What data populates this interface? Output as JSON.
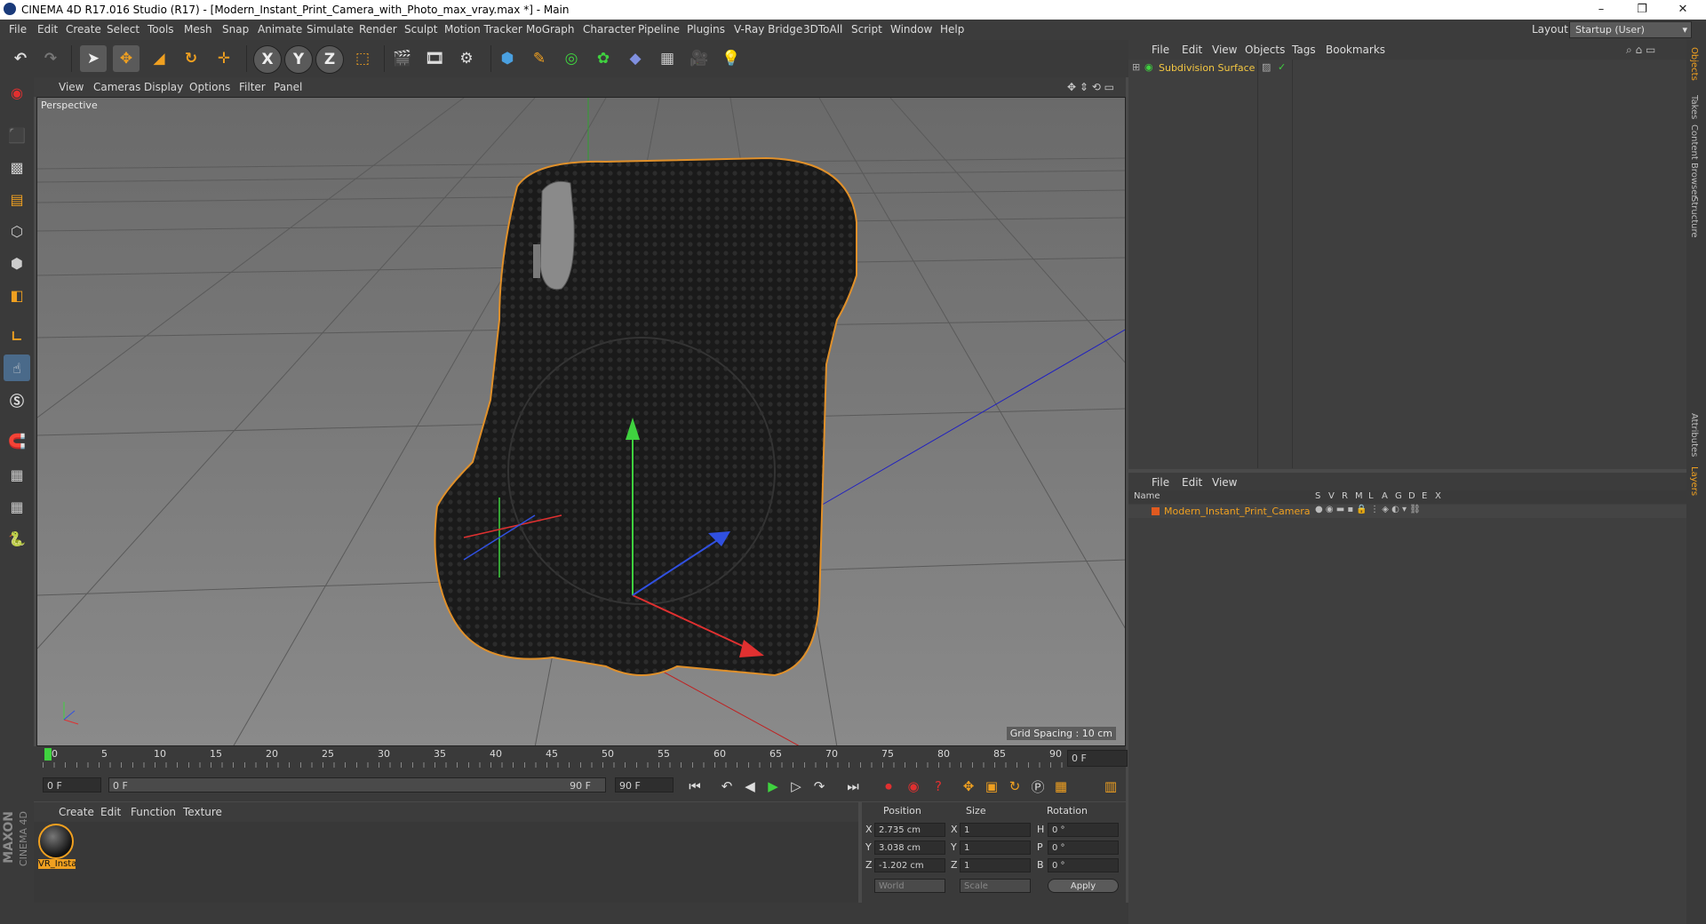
{
  "window": {
    "title": "CINEMA 4D R17.016 Studio (R17) - [Modern_Instant_Print_Camera_with_Photo_max_vray.max *] - Main",
    "controls": [
      "–",
      "❐",
      "✕"
    ]
  },
  "menubar": {
    "items": [
      "File",
      "Edit",
      "Create",
      "Select",
      "Tools",
      "Mesh",
      "Snap",
      "Animate",
      "Simulate",
      "Render",
      "Sculpt",
      "Motion Tracker",
      "MoGraph",
      "Character",
      "Pipeline",
      "Plugins",
      "V-Ray Bridge",
      "3DToAll",
      "Script",
      "Window",
      "Help"
    ],
    "layout_label": "Layout:",
    "layout_value": "Startup (User)"
  },
  "toolbar": {
    "axis_x": "X",
    "axis_y": "Y",
    "axis_z": "Z"
  },
  "viewport": {
    "menu": [
      "View",
      "Cameras",
      "Display",
      "Options",
      "Filter",
      "Panel"
    ],
    "label": "Perspective",
    "grid_spacing": "Grid Spacing : 10 cm"
  },
  "timeline": {
    "ticks": [
      "0",
      "5",
      "10",
      "15",
      "20",
      "25",
      "30",
      "35",
      "40",
      "45",
      "50",
      "55",
      "60",
      "65",
      "70",
      "75",
      "80",
      "85",
      "90"
    ],
    "current_frame": "0 F"
  },
  "transport": {
    "start_field": "0 F",
    "range_start": "0 F",
    "range_end": "90 F",
    "end_field": "90 F"
  },
  "material_manager": {
    "menu": [
      "Create",
      "Edit",
      "Function",
      "Texture"
    ],
    "material_name": "VR_Insta",
    "brand_maxon": "MAXON",
    "brand_c4d": "CINEMA 4D"
  },
  "coordinates": {
    "headers": [
      "Position",
      "Size",
      "Rotation"
    ],
    "rows": [
      {
        "axis": "X",
        "pos": "2.735 cm",
        "size_axis": "X",
        "size": "1",
        "rot_axis": "H",
        "rot": "0 °"
      },
      {
        "axis": "Y",
        "pos": "3.038 cm",
        "size_axis": "Y",
        "size": "1",
        "rot_axis": "P",
        "rot": "0 °"
      },
      {
        "axis": "Z",
        "pos": "-1.202 cm",
        "size_axis": "Z",
        "size": "1",
        "rot_axis": "B",
        "rot": "0 °"
      }
    ],
    "mode_world": "World",
    "mode_scale": "Scale",
    "apply": "Apply"
  },
  "object_manager": {
    "menu": [
      "File",
      "Edit",
      "View",
      "Objects",
      "Tags",
      "Bookmarks"
    ],
    "object_name": "Subdivision Surface"
  },
  "layer_manager": {
    "menu": [
      "File",
      "Edit",
      "View"
    ],
    "col_name": "Name",
    "cols": [
      "S",
      "V",
      "R",
      "M",
      "L",
      "A",
      "G",
      "D",
      "E",
      "X"
    ],
    "layer_name": "Modern_Instant_Print_Camera"
  },
  "right_tabs": [
    "Objects",
    "Takes",
    "Content Browser",
    "Structure",
    "Attributes",
    "Layers"
  ],
  "colors": {
    "accent_orange": "#f0a020",
    "object_yellow": "#f5c842",
    "play_green": "#3fd23f",
    "record_red": "#e03030"
  }
}
